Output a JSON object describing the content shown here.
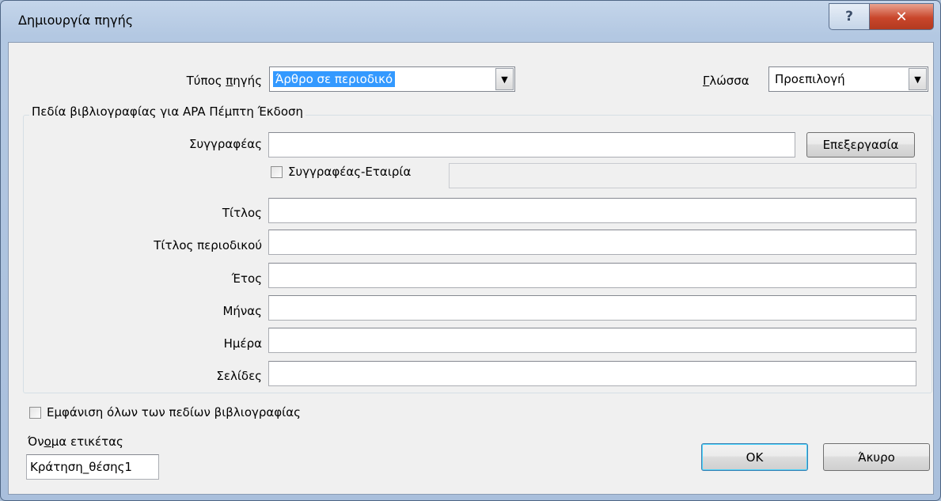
{
  "dialog": {
    "title": "Δημιουργία πηγής",
    "help_glyph": "?",
    "close_glyph": "✕"
  },
  "source_type": {
    "label_before": "Τύπος ",
    "label_ul": "π",
    "label_after": "ηγής",
    "value": "Άρθρο σε περιοδικό"
  },
  "language": {
    "label_ul": "Γ",
    "label_after": "λώσσα",
    "value": "Προεπιλογή"
  },
  "fields_group": {
    "title": "Πεδία βιβλιογραφίας για APA Πέμπτη Έκδοση"
  },
  "author": {
    "label": "Συγγραφέας",
    "value": "",
    "edit_button": "Επεξεργασία",
    "corporate_label": "Συγγραφέας-Εταιρία",
    "corporate_checked": false,
    "corporate_value": ""
  },
  "fields": [
    {
      "label": "Τίτλος",
      "value": ""
    },
    {
      "label": "Τίτλος περιοδικού",
      "value": ""
    },
    {
      "label": "Έτος",
      "value": ""
    },
    {
      "label": "Μήνας",
      "value": ""
    },
    {
      "label": "Ημέρα",
      "value": ""
    },
    {
      "label": "Σελίδες",
      "value": ""
    }
  ],
  "show_all": {
    "label": "Εμφάνιση όλων των πεδίων βιβλιογραφίας",
    "checked": false
  },
  "tag_name": {
    "label_before": "Όν",
    "label_ul": "ο",
    "label_after": "μα ετικέτας",
    "value": "Κράτηση_θέσης1"
  },
  "buttons": {
    "ok": "OK",
    "cancel": "Άκυρο"
  },
  "icons": {
    "dropdown_arrow": "▼"
  }
}
